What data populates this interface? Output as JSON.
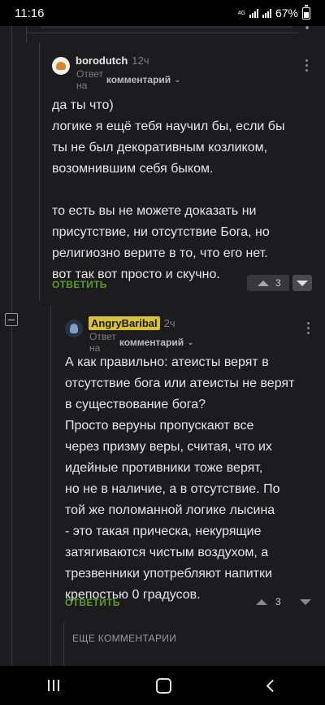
{
  "status_bar": {
    "time": "11:16",
    "network": "4G",
    "battery": "67%",
    "battery_level": 0.67
  },
  "comments": [
    {
      "author": "borodutch",
      "time_ago": "12ч",
      "reply_prefix": "Ответ на",
      "reply_target": "комментарий",
      "avatar_icon": "cat-avatar-icon",
      "text": "да ты что)\nлогике я ещё тебя научил бы, если бы\nты не был декоративным козликом,\nвозомнившим себя быком.\n\nто есть вы не можете доказать ни\nприсутствие, ни отсутствие Бога, но\nрелигиозно верите в то, что его нет.\nвот так вот просто и скучно.",
      "reply_label": "ОТВЕТИТЬ",
      "rating": "3"
    },
    {
      "author": "AngryBaribal",
      "time_ago": "2ч",
      "reply_prefix": "Ответ на",
      "reply_target": "комментарий",
      "avatar_icon": "user-avatar-icon",
      "text": "А как правильно: атеисты верят в\nотсутствие бога или атеисты не верят\nв существование бога?\nПросто веруны пропускают все\nчерез призму веры, считая, что их\nидейные противники тоже верят,\nно не в наличие, а в отсутствие. По\nтой же поломанной логике лысина\n- это такая прическа, некурящие\nзатягиваются чистым воздухом, а\nтрезвенники употребляют напитки\nкрепостью 0 градусов.",
      "reply_label": "ОТВЕТИТЬ",
      "rating": "3"
    }
  ],
  "more_comments_label": "ЕЩЕ КОММЕНТАРИИ",
  "accent_colors": {
    "reply": "#5d9a2c",
    "author_badge": "#d8c23a"
  }
}
